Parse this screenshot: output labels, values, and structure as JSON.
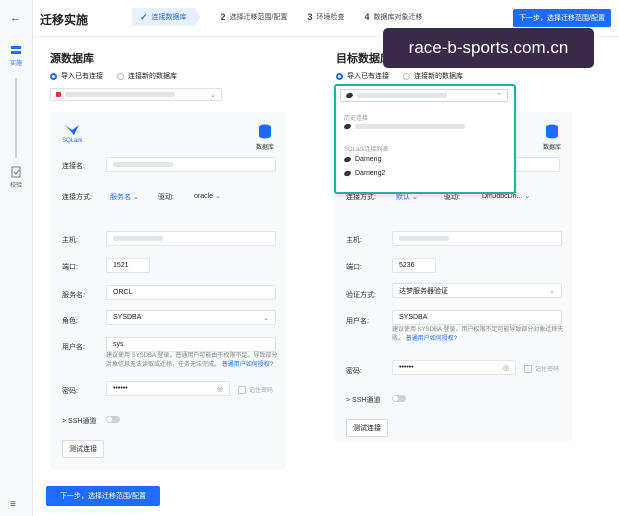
{
  "rail": {
    "back_icon": "←",
    "migrate_label": "实施",
    "verify_label": "校验",
    "menu_icon": "≡"
  },
  "header": {
    "title": "迁移实施",
    "steps": [
      {
        "num": "",
        "label": "连接数据库",
        "active": true
      },
      {
        "num": "2",
        "label": "选择迁移范围/配置"
      },
      {
        "num": "3",
        "label": "环境检查"
      },
      {
        "num": "4",
        "label": "数据库对象迁移"
      }
    ],
    "next_button": "下一步，选择迁移范围/配置"
  },
  "source": {
    "title": "源数据库",
    "radio_existing": "导入已有连接",
    "radio_new": "连接新的数据库",
    "logo_text": "SQLark",
    "db_label": "数据库",
    "conn_name_label": "连接名:",
    "conn_method_label": "连接方式:",
    "conn_method_value": "服务名",
    "driver_label": "驱动:",
    "driver_value": "oracle",
    "host_label": "主机:",
    "port_label": "端口:",
    "port_value": "1521",
    "service_label": "服务名:",
    "service_value": "ORCL",
    "role_label": "角色:",
    "role_value": "SYSDBA",
    "user_label": "用户名:",
    "user_value": "sys",
    "user_hint": "建议使用 SYSDBA 登录，普通用户可能由于权限不足，导致部分对象信息无法读取或迁移，任务无法完成。",
    "user_hint_link": "普通用户如何授权?",
    "password_label": "密码:",
    "password_value": "••••••",
    "remember_label": "记住密码",
    "ssh_label": "SSH通道",
    "test_button": "测试连接"
  },
  "target": {
    "title": "目标数据库",
    "radio_existing": "导入已有连接",
    "radio_new": "连接新的数据库",
    "db_label": "数据库",
    "conn_method_label": "连接方式:",
    "conn_method_value": "默认",
    "driver_label": "驱动:",
    "driver_value": "DmJdbcDri...",
    "host_label": "主机:",
    "port_label": "端口:",
    "port_value": "5236",
    "auth_label": "验证方式:",
    "auth_value": "达梦服务器验证",
    "user_label": "用户名:",
    "user_value": "SYSDBA",
    "user_hint": "建议使用 SYSDBA 登录，用户权限不足可能导致部分对象迁移失败。",
    "user_hint_link": "普通用户如何授权?",
    "password_label": "密码:",
    "password_value": "••••••",
    "remember_label": "记住密码",
    "ssh_label": "SSH通道",
    "test_button": "测试连接",
    "dropdown": {
      "recent_label": "历史连接",
      "group_label": "SQLark连接列表",
      "items": [
        "Dameng",
        "Dameng2"
      ]
    }
  },
  "footer": {
    "next_button": "下一步，选择迁移范围/配置"
  },
  "watermark": "race-b-sports.com.cn",
  "colors": {
    "accent": "#1f6bff",
    "highlight": "#23b39a"
  }
}
